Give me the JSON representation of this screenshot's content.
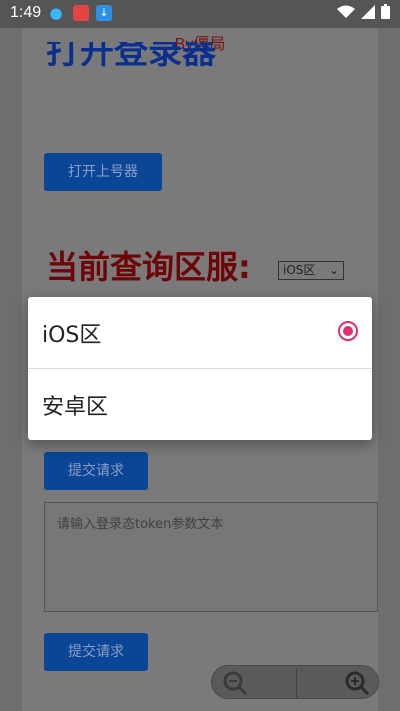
{
  "status_bar": {
    "time": "1:49"
  },
  "page": {
    "byline": "By僵局",
    "title_partial": "打开登录器",
    "open_button": "打开上号器",
    "region_heading": "当前查询区服:",
    "region_select": "iOS区",
    "submit_button_1": "提交请求",
    "token_placeholder": "请输入登录态token参数文本",
    "submit_button_2": "提交请求"
  },
  "dialog": {
    "options": [
      {
        "label": "iOS区",
        "selected": true
      },
      {
        "label": "安卓区",
        "selected": false
      }
    ]
  },
  "colors": {
    "accent": "#e0326a",
    "button": "#0b4595",
    "heading": "#6e0406"
  }
}
